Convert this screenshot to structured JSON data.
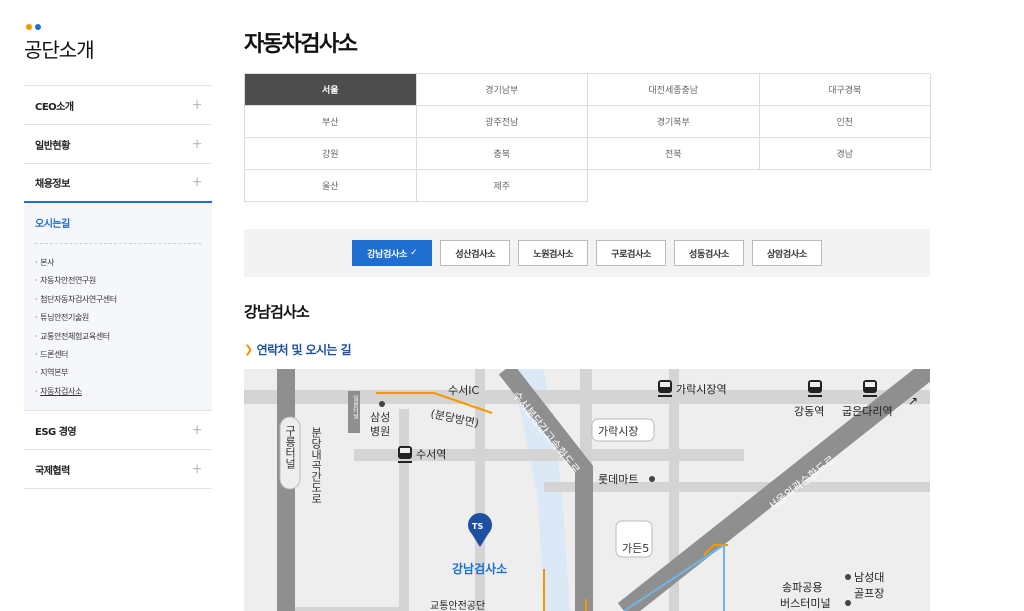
{
  "sidebar": {
    "title": "공단소개",
    "dot_colors": [
      "#f39800",
      "#1e6fd0"
    ],
    "menu": [
      {
        "label": "CEO소개",
        "toggle": "+"
      },
      {
        "label": "일반현황",
        "toggle": "+"
      },
      {
        "label": "채용정보",
        "toggle": "+"
      }
    ],
    "submenu": {
      "title": "오시는길",
      "items": [
        "본사",
        "자동차안전연구원",
        "첨단자동차검사연구센터",
        "튜닝안전기술원",
        "교통안전체험교육센터",
        "드론센터",
        "지역본부",
        "자동차검사소"
      ]
    },
    "menu_after": [
      {
        "label": "ESG 경영",
        "toggle": "+"
      },
      {
        "label": "국제협력",
        "toggle": "+"
      }
    ]
  },
  "main": {
    "page_title": "자동차검사소",
    "regions": [
      "서울",
      "경기남부",
      "대전세종충남",
      "대구경북",
      "부산",
      "광주전남",
      "경기북부",
      "인천",
      "강원",
      "충북",
      "전북",
      "경남",
      "울산",
      "제주"
    ],
    "active_region": "서울",
    "offices": [
      {
        "label": "강남검사소",
        "active": true,
        "check": "✓"
      },
      {
        "label": "성산검사소"
      },
      {
        "label": "노원검사소"
      },
      {
        "label": "구로검사소"
      },
      {
        "label": "성동검사소"
      },
      {
        "label": "상암검사소"
      }
    ],
    "section_title": "강남검사소",
    "sub_title": "연락처 및 오시는 길",
    "sub_title_arrow": "❯"
  },
  "map": {
    "labels": {
      "suseo_ic": "수서IC",
      "bundang_direction": "(분당방면)",
      "samsung": "삼성",
      "hospital": "병원",
      "ilwon_tunnel": "일원터널",
      "guryong_tunnel": "구룡터널",
      "bundang_road": "분당내곡간도로",
      "suseo_station": "수서역",
      "garak_market": "가락시장",
      "garak_station": "가락시장역",
      "gangdong_station": "강동역",
      "gubeundari_station": "굽은다리역",
      "suseo_expressway": "수서분당간고속화도로",
      "lotte_mart": "롯데마트",
      "seoul_ring_road": "서울외곽순환도로",
      "garden5": "가든5",
      "ts_logo": "TS",
      "gangnam_center": "강남검사소",
      "safety_institute": "교통안전공단",
      "songpa_bus": "송파공용",
      "bus_terminal": "버스터미널",
      "namseong": "남성대",
      "golf": "골프장"
    },
    "colors": {
      "road": "#d6d6d6",
      "highway": "#8f8f8f",
      "river": "#dbe9f7",
      "accent": "#f39800",
      "pin": "#1e4fa0",
      "label_blue": "#1e6fd0"
    }
  }
}
